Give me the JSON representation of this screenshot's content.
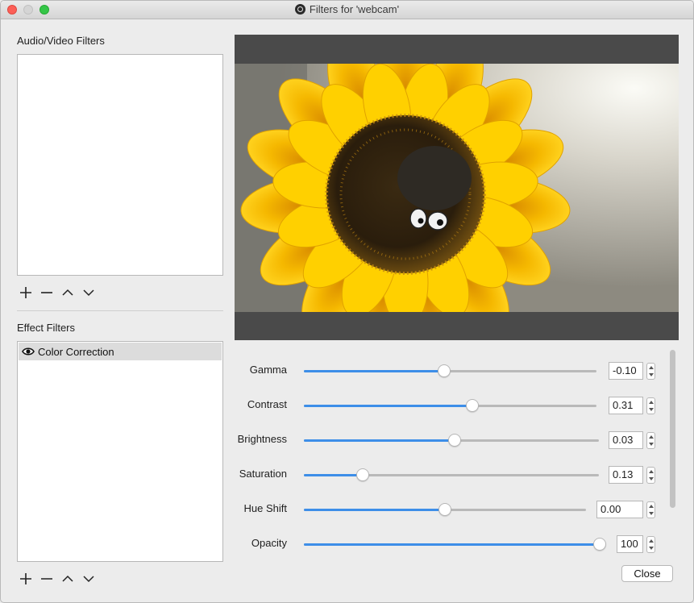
{
  "window": {
    "title": "Filters for 'webcam'"
  },
  "audio_video": {
    "heading": "Audio/Video Filters",
    "items": []
  },
  "effect": {
    "heading": "Effect Filters",
    "items": [
      {
        "label": "Color Correction",
        "visible": true,
        "selected": true
      }
    ]
  },
  "toolbar_icons": [
    "plus-icon",
    "minus-icon",
    "chevron-up-icon",
    "chevron-down-icon"
  ],
  "properties": [
    {
      "label": "Gamma",
      "value": "-0.10",
      "slider_fraction": 0.48
    },
    {
      "label": "Contrast",
      "value": "0.31",
      "slider_fraction": 0.575
    },
    {
      "label": "Brightness",
      "value": "0.03",
      "slider_fraction": 0.51
    },
    {
      "label": "Saturation",
      "value": "0.13",
      "slider_fraction": 0.2
    },
    {
      "label": "Hue Shift",
      "value": "0.00",
      "slider_fraction": 0.5
    },
    {
      "label": "Opacity",
      "value": "100",
      "slider_fraction": 1.0
    }
  ],
  "footer": {
    "close_label": "Close"
  },
  "colors": {
    "accent": "#3d8ee8",
    "preview_bg": "#4a4a4a"
  }
}
